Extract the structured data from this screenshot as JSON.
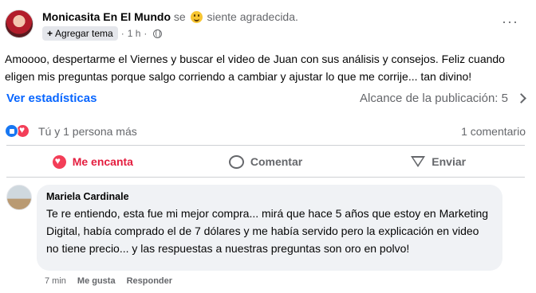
{
  "post": {
    "author": "Monicasita En El Mundo",
    "feeling_prefix": "se",
    "feeling_text": "siente agradecida.",
    "tag_button": "Agregar tema",
    "time": "1 h",
    "text": "Amoooo, despertarme el Viernes y buscar el video de Juan con sus análisis y consejos. Feliz cuando eligen mis preguntas porque salgo corriendo a cambiar y ajustar lo que me corrije... tan divino!",
    "stats_link": "Ver estadísticas",
    "reach_label": "Alcance de la publicación:",
    "reach_value": "5",
    "reactions_text": "Tú y 1 persona más",
    "comments_count": "1 comentario"
  },
  "actions": {
    "love": "Me encanta",
    "comment": "Comentar",
    "send": "Enviar"
  },
  "comment": {
    "author": "Mariela Cardinale",
    "text": "Te re entiendo, esta fue mi mejor compra... mirá que hace 5 años que estoy en Marketing Digital, había comprado el de 7 dólares y me había servido pero la explicación en video no tiene precio... y las respuestas a nuestras preguntas son oro en polvo!",
    "time": "7 min",
    "like": "Me gusta",
    "reply": "Responder"
  },
  "colors": {
    "accent": "#0866ff",
    "love": "#e41e3f",
    "secondary_text": "#65676b",
    "bubble": "#f0f2f5"
  }
}
